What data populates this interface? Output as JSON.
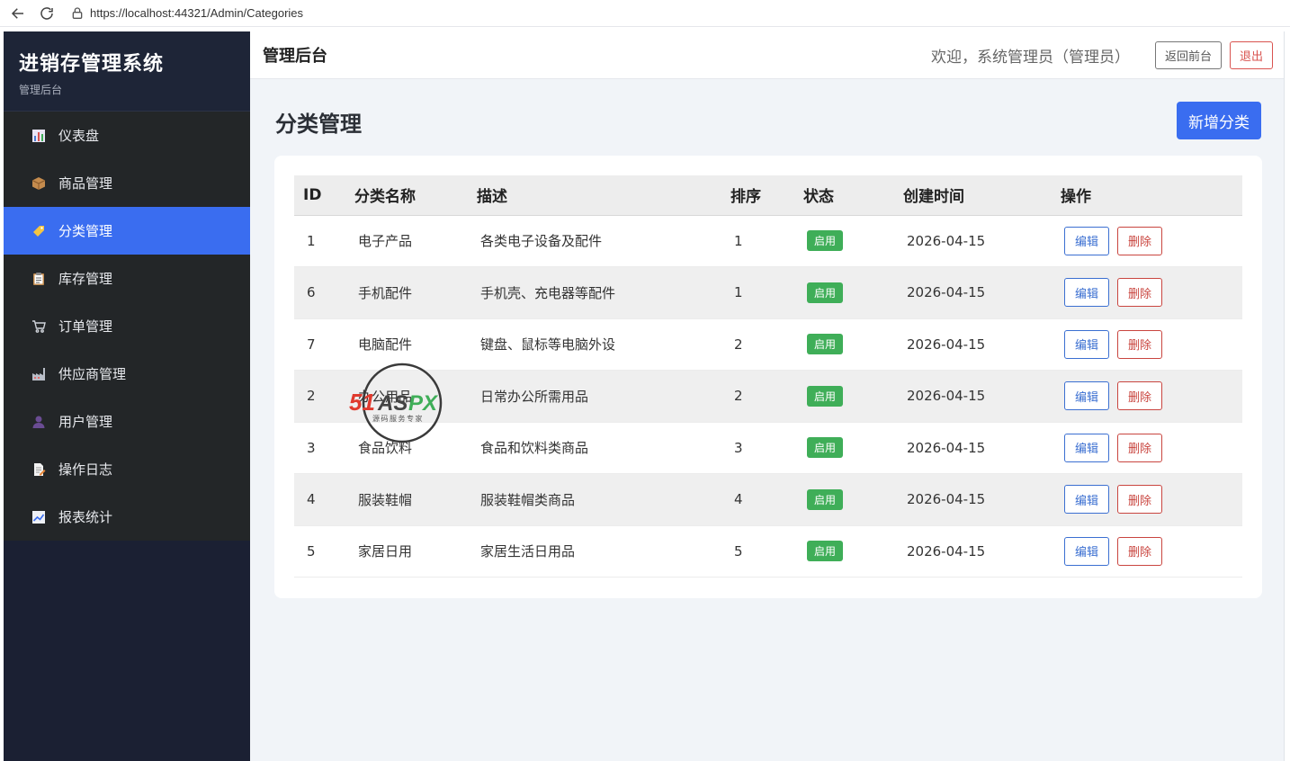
{
  "browser": {
    "url": "https://localhost:44321/Admin/Categories"
  },
  "sidebar": {
    "brand_title": "进销存管理系统",
    "brand_subtitle": "管理后台",
    "items": [
      {
        "label": "仪表盘",
        "icon": "bar-chart-icon"
      },
      {
        "label": "商品管理",
        "icon": "package-icon"
      },
      {
        "label": "分类管理",
        "icon": "tag-icon",
        "active": true
      },
      {
        "label": "库存管理",
        "icon": "clipboard-icon"
      },
      {
        "label": "订单管理",
        "icon": "cart-icon"
      },
      {
        "label": "供应商管理",
        "icon": "factory-icon"
      },
      {
        "label": "用户管理",
        "icon": "user-icon"
      },
      {
        "label": "操作日志",
        "icon": "document-icon"
      },
      {
        "label": "报表统计",
        "icon": "trend-chart-icon"
      }
    ]
  },
  "topbar": {
    "title": "管理后台",
    "welcome": "欢迎，系统管理员（管理员）",
    "back_label": "返回前台",
    "logout_label": "退出"
  },
  "page": {
    "title": "分类管理",
    "add_label": "新增分类"
  },
  "table": {
    "columns": [
      "ID",
      "分类名称",
      "描述",
      "排序",
      "状态",
      "创建时间",
      "操作"
    ],
    "edit_label": "编辑",
    "delete_label": "删除",
    "rows": [
      {
        "id": "1",
        "name": "电子产品",
        "desc": "各类电子设备及配件",
        "sort": "1",
        "status": "启用",
        "created": "2026-04-15"
      },
      {
        "id": "6",
        "name": "手机配件",
        "desc": "手机壳、充电器等配件",
        "sort": "1",
        "status": "启用",
        "created": "2026-04-15"
      },
      {
        "id": "7",
        "name": "电脑配件",
        "desc": "键盘、鼠标等电脑外设",
        "sort": "2",
        "status": "启用",
        "created": "2026-04-15"
      },
      {
        "id": "2",
        "name": "办公用品",
        "desc": "日常办公所需用品",
        "sort": "2",
        "status": "启用",
        "created": "2026-04-15"
      },
      {
        "id": "3",
        "name": "食品饮料",
        "desc": "食品和饮料类商品",
        "sort": "3",
        "status": "启用",
        "created": "2026-04-15"
      },
      {
        "id": "4",
        "name": "服装鞋帽",
        "desc": "服装鞋帽类商品",
        "sort": "4",
        "status": "启用",
        "created": "2026-04-15"
      },
      {
        "id": "5",
        "name": "家居日用",
        "desc": "家居生活日用品",
        "sort": "5",
        "status": "启用",
        "created": "2026-04-15"
      }
    ]
  },
  "watermark": {
    "text": "51ASPX",
    "sub": "源码服务专家"
  },
  "colors": {
    "sidebar_bg": "#1b2033",
    "accent": "#3a6df0",
    "success": "#3fae58",
    "danger": "#c9453f"
  }
}
